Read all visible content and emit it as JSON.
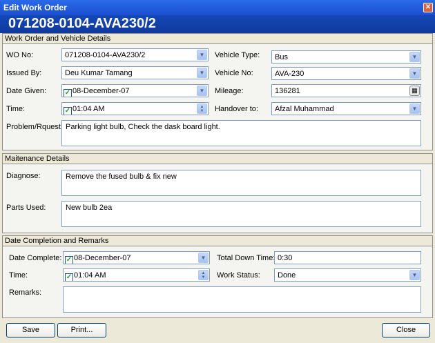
{
  "window": {
    "title": "Edit Work Order",
    "header": "071208-0104-AVA230/2"
  },
  "icons": {
    "close": "close-icon",
    "dropdown": "chevron-down-icon",
    "spin": "spin-arrows-icon",
    "calculator": "calculator-icon"
  },
  "colors": {
    "title_bar": "#2a6ae8",
    "header_bar": "#1447b8",
    "check": "#21a121"
  },
  "work_order": {
    "section_title": "Work Order and Vehicle Details",
    "wo_no_label": "WO No:",
    "wo_no": "071208-0104-AVA230/2",
    "issued_by_label": "Issued By:",
    "issued_by": "Deu Kumar Tamang",
    "date_given_label": "Date Given:",
    "date_given": "08-December-07",
    "time_label": "Time:",
    "time": "01:04 AM",
    "problem_label": "Problem/Rquest:",
    "problem": "Parking light bulb, Check the dask board light.",
    "vehicle_type_label": "Vehicle Type:",
    "vehicle_type": "Bus",
    "vehicle_no_label": "Vehicle No:",
    "vehicle_no": "AVA-230",
    "mileage_label": "Mileage:",
    "mileage": "136281",
    "handover_label": "Handover to:",
    "handover": "Afzal  Muhammad"
  },
  "maintenance": {
    "section_title": "Maitenance Details",
    "diagnose_label": "Diagnose:",
    "diagnose": "Remove the fused bulb & fix new",
    "parts_label": "Parts Used:",
    "parts": "New bulb 2ea"
  },
  "completion": {
    "section_title": "Date Completion and Remarks",
    "date_complete_label": "Date Complete:",
    "date_complete": "08-December-07",
    "time_label": "Time:",
    "time": "01:04 AM",
    "remarks_label": "Remarks:",
    "remarks": "",
    "down_time_label": "Total Down Time:",
    "down_time": "0:30",
    "status_label": "Work Status:",
    "status": "Done"
  },
  "buttons": {
    "save": "Save",
    "print": "Print...",
    "close": "Close"
  }
}
